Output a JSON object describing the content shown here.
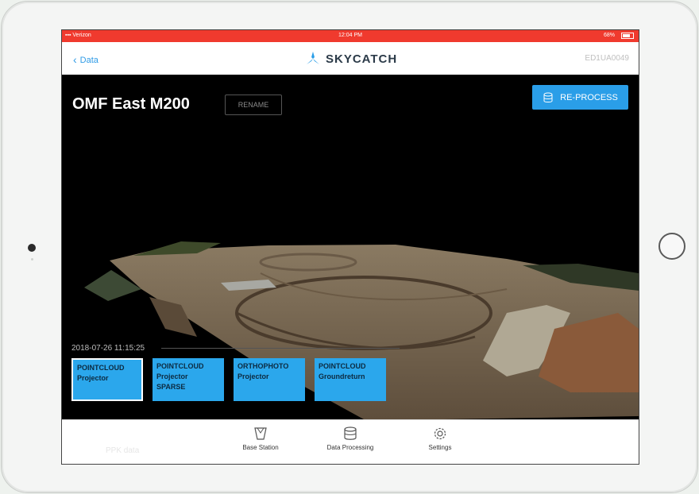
{
  "status_bar": {
    "carrier": "Verizon",
    "time": "12:04 PM",
    "battery": "68%"
  },
  "nav": {
    "back_label": "Data",
    "app_name": "SKYCATCH",
    "serial": "ED1UA0049"
  },
  "dataset": {
    "title": "OMF East M200",
    "rename_label": "RENAME",
    "reprocess_label": "RE-PROCESS",
    "timestamp": "2018-07-26 11:15:25"
  },
  "outputs": [
    {
      "type": "POINTCLOUD",
      "subtitle": "Projector",
      "extra": "",
      "selected": true
    },
    {
      "type": "POINTCLOUD",
      "subtitle": "Projector",
      "extra": "SPARSE",
      "selected": false
    },
    {
      "type": "ORTHOPHOTO",
      "subtitle": "Projector",
      "extra": "",
      "selected": false
    },
    {
      "type": "POINTCLOUD",
      "subtitle": "Groundreturn",
      "extra": "",
      "selected": false
    }
  ],
  "tabs": [
    {
      "label": "Base Station",
      "icon": "base-station-icon"
    },
    {
      "label": "Data Processing",
      "icon": "database-icon"
    },
    {
      "label": "Settings",
      "icon": "gear-icon"
    }
  ],
  "tabbar_ghost_text": "PPK data",
  "colors": {
    "status_red": "#f03a2e",
    "accent_blue": "#2a9ee8",
    "tile_blue": "#2ba7ec"
  }
}
